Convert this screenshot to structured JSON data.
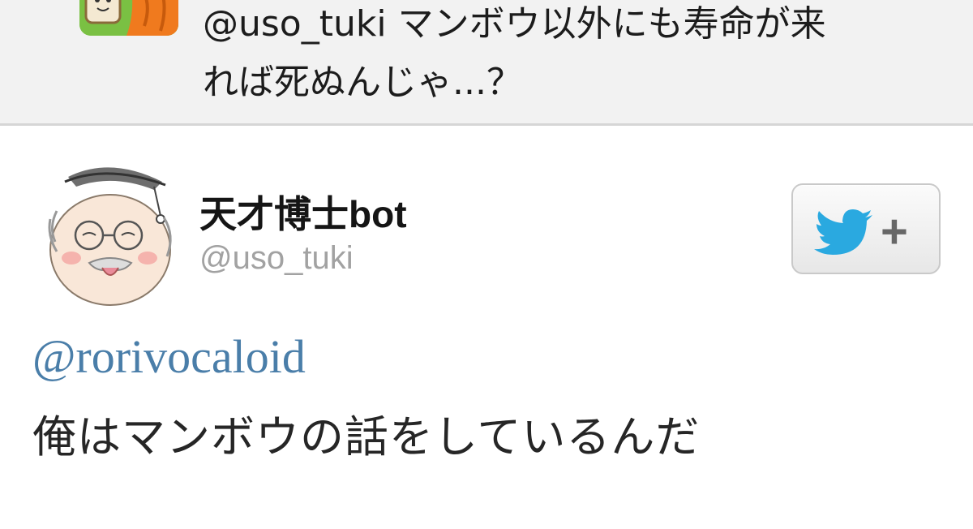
{
  "reply": {
    "avatar_icon": "toast-character-avatar-icon",
    "mention": "@uso_tuki",
    "text_line1": " マンボウ以外にも寿命が来",
    "text_line2": "れば死ぬんじゃ...？"
  },
  "tweet": {
    "author_name": "天才博士bot",
    "author_handle": "@uso_tuki",
    "avatar_icon": "professor-avatar-icon",
    "follow_button": {
      "icon": "twitter-bird-icon",
      "plus_label": "+"
    },
    "mention": "@rorivocaloid",
    "text": "俺はマンボウの話をしているんだ"
  },
  "colors": {
    "reply_background": "#f2f2f2",
    "mention_link": "#4a7ea9",
    "handle_gray": "#a2a2a2",
    "twitter_blue": "#2aa9e0"
  }
}
